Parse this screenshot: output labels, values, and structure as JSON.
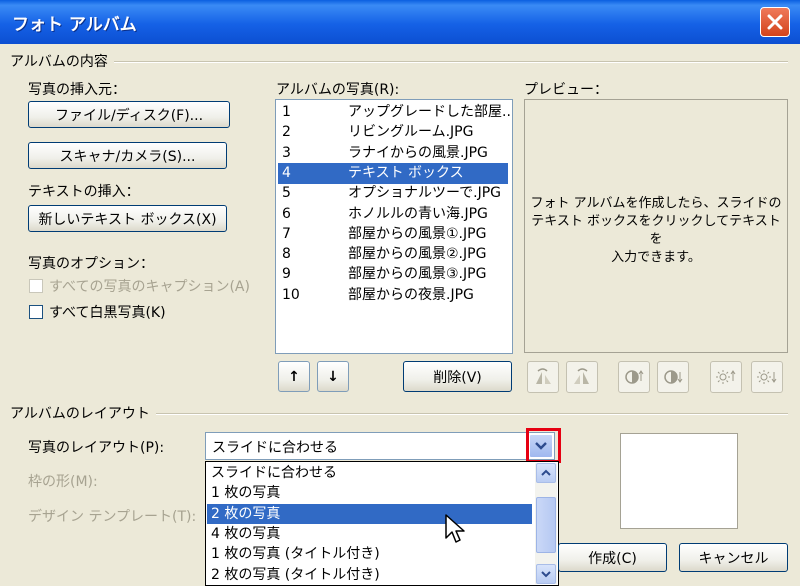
{
  "window": {
    "title": "フォト アルバム"
  },
  "album_contents": {
    "group_title": "アルバムの内容",
    "insert_from_label": "写真の挿入元：",
    "file_disk_button": "ファイル/ディスク(F)...",
    "scanner_camera_button": "スキャナ/カメラ(S)...",
    "insert_text_label": "テキストの挿入：",
    "new_textbox_button": "新しいテキスト ボックス(X)",
    "photo_options_label": "写真のオプション：",
    "all_captions_checkbox": "すべての写真のキャプション(A)",
    "all_bw_checkbox": "すべて白黒写真(K)"
  },
  "album_photos": {
    "label": "アルバムの写真(R):",
    "items": [
      {
        "num": "1",
        "name": "アップグレードした部屋.."
      },
      {
        "num": "2",
        "name": "リビングルーム.JPG"
      },
      {
        "num": "3",
        "name": "ラナイからの風景.JPG"
      },
      {
        "num": "4",
        "name": "テキスト ボックス"
      },
      {
        "num": "5",
        "name": "オプショナルツーで.JPG"
      },
      {
        "num": "6",
        "name": "ホノルルの青い海.JPG"
      },
      {
        "num": "7",
        "name": "部屋からの風景①.JPG"
      },
      {
        "num": "8",
        "name": "部屋からの風景②.JPG"
      },
      {
        "num": "9",
        "name": "部屋からの風景③.JPG"
      },
      {
        "num": "10",
        "name": "部屋からの夜景.JPG"
      }
    ],
    "selected_index": 3,
    "move_up_symbol": "↑",
    "move_down_symbol": "↓",
    "delete_button": "削除(V)"
  },
  "preview": {
    "label": "プレビュー：",
    "message_line1": "フォト アルバムを作成したら、スライドの",
    "message_line2": "テキスト ボックスをクリックしてテキストを",
    "message_line3": "入力できます。"
  },
  "album_layout": {
    "group_title": "アルバムのレイアウト",
    "picture_layout_label": "写真のレイアウト(P):",
    "picture_layout_value": "スライドに合わせる",
    "frame_shape_label": "枠の形(M):",
    "design_template_label": "デザイン テンプレート(T):",
    "options": [
      "スライドに合わせる",
      "1 枚の写真",
      "2 枚の写真",
      "4 枚の写真",
      "1 枚の写真 (タイトル付き)",
      "2 枚の写真 (タイトル付き)"
    ],
    "highlighted_option_index": 2
  },
  "buttons": {
    "create": "作成(C)",
    "cancel": "キャンセル"
  },
  "colors": {
    "titlebar": "#0a5fe0",
    "selection": "#316ac5",
    "highlight_box": "#e60012"
  }
}
